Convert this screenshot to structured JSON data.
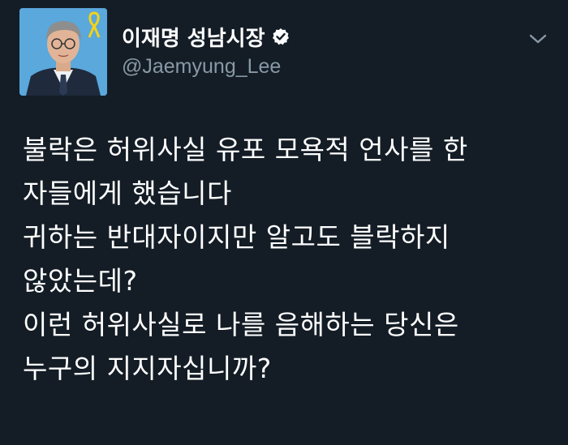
{
  "profile": {
    "display_name": "이재명 성남시장",
    "handle": "@Jaemyung_Lee",
    "verified": true,
    "avatar_ribbon_color": "#f2d21a",
    "avatar_bg_color": "#5aa8dc"
  },
  "menu": {
    "icon": "chevron-down-icon"
  },
  "tweet": {
    "lines": [
      "불락은 허위사실 유포 모욕적 언사를 한",
      "자들에게 했습니다",
      "귀하는 반대자이지만 알고도 블락하지",
      "않았는데?",
      "이런 허위사실로 나를 음해하는 당신은",
      "누구의 지지자십니까?"
    ]
  },
  "colors": {
    "background": "#141d26",
    "text": "#ffffff",
    "muted": "#8899a6"
  }
}
